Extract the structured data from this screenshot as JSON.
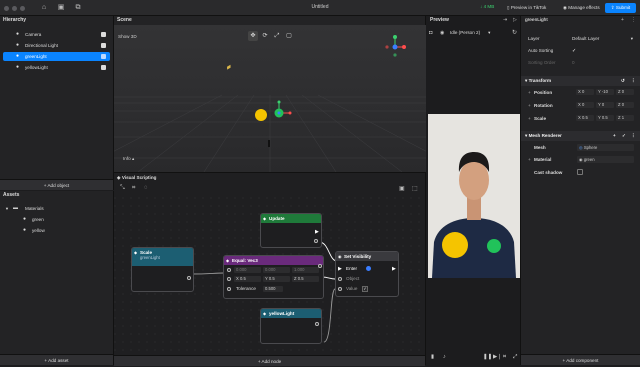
{
  "app": {
    "title": "Untitled",
    "mb": "↓ 4 MB",
    "preview_btn": "Preview in TikTok",
    "manage_btn": "Manage effects",
    "submit_btn": "Submit"
  },
  "hierarchy": {
    "title": "Hierarchy",
    "items": [
      {
        "label": "Camera"
      },
      {
        "label": "Directional Light"
      },
      {
        "label": "greenLight"
      },
      {
        "label": "yellowLight"
      }
    ],
    "add_button": "+ Add object"
  },
  "assets": {
    "title": "Assets",
    "folder": "Materials",
    "items": [
      "green",
      "yellow"
    ],
    "add_button": "+ Add asset"
  },
  "scene": {
    "title": "Scene",
    "view_mode": "Show 3D",
    "info_label": "Info"
  },
  "visual_scripting": {
    "title": "Visual Scripting",
    "add_node": "+ Add node",
    "nodes": {
      "update": {
        "title": "Update"
      },
      "scale": {
        "title": "Scale",
        "subtitle": "greenLight"
      },
      "equal": {
        "title": "Equal: Vec3",
        "r1": [
          "0.000",
          "0.000",
          "1.000"
        ],
        "r2": [
          "0.5",
          "0.5",
          "0.5"
        ],
        "r2labels": [
          "X",
          "Y",
          "Z"
        ],
        "tolerance_label": "Tolerance",
        "tolerance": "0.500"
      },
      "setvis": {
        "title": "Set Visibility",
        "ports": [
          "Enter",
          "Object",
          "Value"
        ]
      },
      "yellow": {
        "title": "yellowLight"
      }
    }
  },
  "preview": {
    "title": "Preview",
    "mode": "Idle (Person 2)"
  },
  "inspector": {
    "object_name": "greenLight",
    "layer_label": "Layer",
    "layer_value": "Default Layer",
    "auto_sorting": "Auto Sorting",
    "sorting_order": "Sorting Order",
    "transform": {
      "title": "Transform",
      "rows": [
        {
          "label": "Position",
          "x": "0",
          "y": "-10",
          "z": "0"
        },
        {
          "label": "Rotation",
          "x": "0",
          "y": "0",
          "z": "0"
        },
        {
          "label": "Scale",
          "x": "0.5",
          "y": "0.5",
          "z": "1"
        }
      ]
    },
    "mesh": {
      "title": "Mesh Renderer",
      "mesh_label": "Mesh",
      "mesh_value": "Sphere",
      "material_label": "Material",
      "material_value": "green",
      "shadow_label": "Cast shadow"
    },
    "add_component": "+ Add component"
  },
  "colors": {
    "accent": "#0a84ff",
    "green_node": "#1f7a3a",
    "cyan_node": "#1c5e72",
    "purple_node": "#6a2a7c",
    "yellow_light": "#f5c400",
    "green_light": "#21c25a"
  }
}
